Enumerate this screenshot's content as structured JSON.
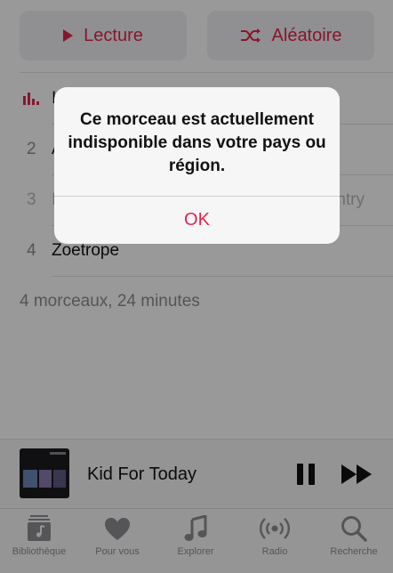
{
  "actions": {
    "play_label": "Lecture",
    "shuffle_label": "Aléatoire"
  },
  "tracks": [
    {
      "number": "",
      "title": "I",
      "extra": "",
      "playing": true
    },
    {
      "number": "2",
      "title": "A",
      "extra": ""
    },
    {
      "number": "3",
      "title": "I",
      "extra": "ntry",
      "dimmed": true
    },
    {
      "number": "4",
      "title": "Zoetrope",
      "extra": ""
    }
  ],
  "summary": "4 morceaux, 24 minutes",
  "mini_player": {
    "title": "Kid For Today",
    "pause_icon": "pause-icon",
    "forward_icon": "fast-forward-icon"
  },
  "tabbar": [
    {
      "label": "Bibliothèque",
      "icon": "library-icon"
    },
    {
      "label": "Pour vous",
      "icon": "heart-icon"
    },
    {
      "label": "Explorer",
      "icon": "music-note-icon"
    },
    {
      "label": "Radio",
      "icon": "radio-icon"
    },
    {
      "label": "Recherche",
      "icon": "search-icon"
    }
  ],
  "alert": {
    "message": "Ce morceau est actuellement indisponible dans votre pays ou région.",
    "button_label": "OK"
  },
  "colors": {
    "accent": "#e3264b",
    "overlay": "rgba(0,0,0,0.40)"
  }
}
